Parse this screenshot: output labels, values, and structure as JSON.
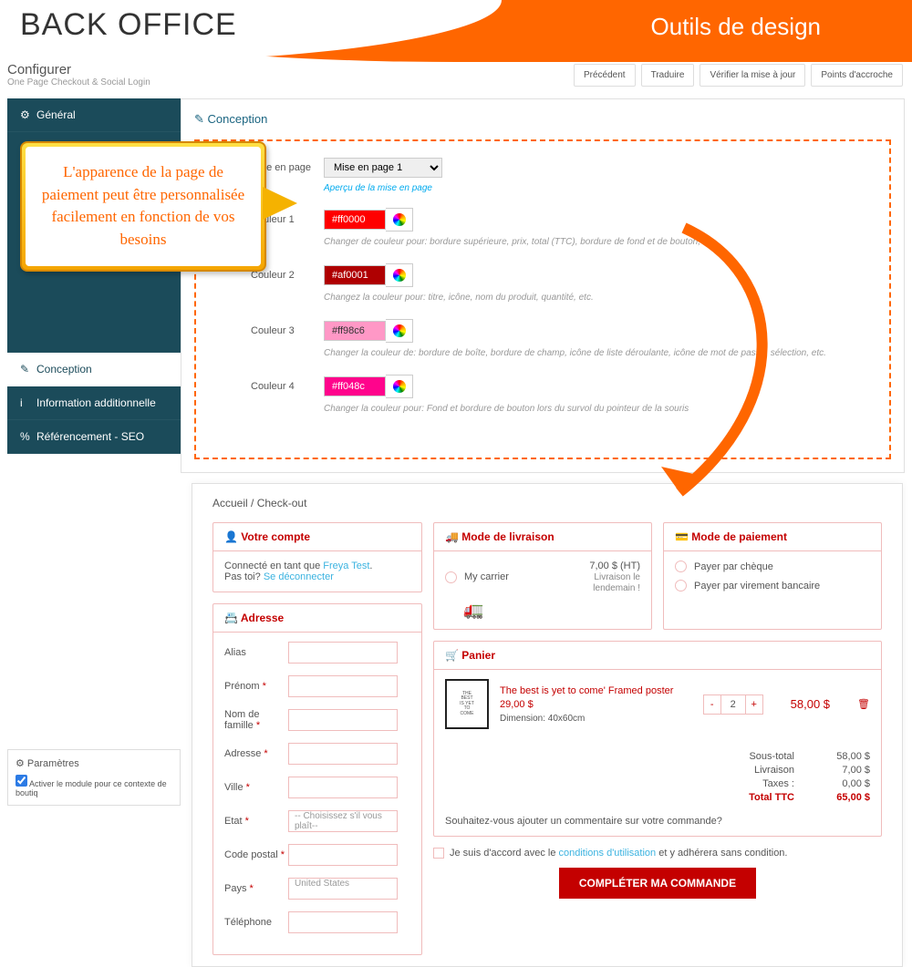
{
  "header": {
    "back_office": "BACK OFFICE",
    "design_tools": "Outils de design"
  },
  "configure": {
    "title": "Configurer",
    "sub": "One Page Checkout & Social Login"
  },
  "top_buttons": {
    "prev": "Précédent",
    "trans": "Traduire",
    "check": "Vérifier la mise à jour",
    "hooks": "Points d'accroche"
  },
  "sidebar": {
    "general": "Général",
    "design": "Conception",
    "addl": "Information additionnelle",
    "seo": "Référencement - SEO"
  },
  "panel": {
    "title": "Conception",
    "layout_lbl": "Mise en page",
    "layout_val": "Mise en page 1",
    "preview": "Aperçu de la mise en page",
    "c1_lbl": "Couleur 1",
    "c1": "#ff0000",
    "c1_hint": "Changer de couleur pour: bordure supérieure, prix, total (TTC), bordure de fond et de bouton, etc.",
    "c2_lbl": "Couleur 2",
    "c2": "#af0001",
    "c2_hint": "Changez la couleur pour: titre, icône, nom du produit, quantité, etc.",
    "c3_lbl": "Couleur 3",
    "c3": "#ff98c6",
    "c3_hint": "Changer la couleur de: bordure de boîte, bordure de champ, icône de liste déroulante, icône de mot de passe, sélection, etc.",
    "c4_lbl": "Couleur 4",
    "c4": "#ff048c",
    "c4_hint": "Changer la couleur pour: Fond et bordure de bouton lors du survol du pointeur de la souris"
  },
  "callout": "L'apparence de la page de paiement peut être personnalisée facilement en fonction de vos besoins",
  "params": {
    "title": "Paramètres",
    "check": "Activer le module pour ce contexte de boutiq"
  },
  "preview": {
    "breadcrumb_home": "Accueil",
    "breadcrumb_sep": "/",
    "breadcrumb_page": "Check-out",
    "account": {
      "title": "Votre compte",
      "logged": "Connecté en tant que ",
      "user": "Freya Test",
      "notyou": "Pas toi? ",
      "logout": "Se déconnecter"
    },
    "address": {
      "title": "Adresse",
      "alias": "Alias",
      "firstname": "Prénom",
      "lastname": "Nom de famille",
      "addr": "Adresse",
      "city": "Ville",
      "state": "Etat",
      "state_ph": "-- Choisissez s'il vous plaît--",
      "zip": "Code postal",
      "country": "Pays",
      "country_val": "United States",
      "phone": "Téléphone"
    },
    "shipping": {
      "title": "Mode de livraison",
      "carrier": "My carrier",
      "price": "7,00 $ (HT)",
      "note1": "Livraison le",
      "note2": "lendemain !"
    },
    "payment": {
      "title": "Mode de paiement",
      "cheque": "Payer par chèque",
      "wire": "Payer par virement bancaire"
    },
    "cart": {
      "title": "Panier",
      "pname": "The best is yet to come' Framed poster",
      "pprice": "29,00 $",
      "pdim": "Dimension: 40x60cm",
      "qty": "2",
      "line": "58,00 $",
      "subtotal_l": "Sous-total",
      "subtotal": "58,00 $",
      "ship_l": "Livraison",
      "ship": "7,00 $",
      "tax_l": "Taxes :",
      "tax": "0,00 $",
      "ttc_l": "Total TTC",
      "ttc": "65,00 $",
      "comment": "Souhaitez-vous ajouter un commentaire sur votre commande?"
    },
    "agree_pre": "Je suis d'accord avec le ",
    "agree_link": "conditions d'utilisation",
    "agree_post": " et y adhérera sans condition.",
    "complete": "COMPLÉTER MA COMMANDE"
  }
}
